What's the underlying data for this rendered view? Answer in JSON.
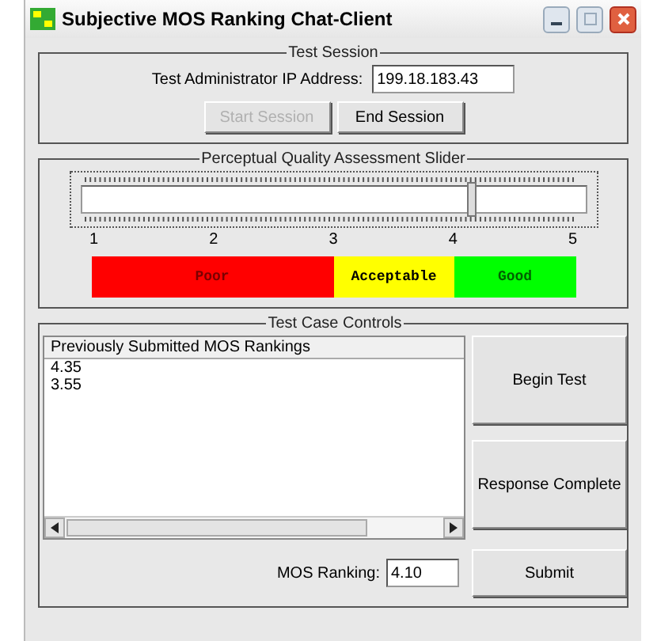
{
  "window": {
    "title": "Subjective MOS Ranking Chat-Client"
  },
  "test_session": {
    "title": "Test Session",
    "ip_label": "Test Administrator IP Address:",
    "ip_value": "199.18.183.43",
    "buttons": [
      {
        "label": "Start Session",
        "disabled": true
      },
      {
        "label": "End Session",
        "disabled": false
      }
    ]
  },
  "slider": {
    "title": "Perceptual Quality Assessment Slider",
    "level": 0.775,
    "scale": [
      "1",
      "2",
      "3",
      "4",
      "5"
    ],
    "zones": [
      {
        "label": "Poor",
        "color": "#ff0000"
      },
      {
        "label": "Acceptable",
        "color": "#ffff00"
      },
      {
        "label": "Good",
        "color": "#00ff00"
      }
    ]
  },
  "test_case": {
    "title": "Test Case Controls",
    "list_header": "Previously Submitted MOS Rankings",
    "rankings": [
      "4.35",
      "3.55"
    ],
    "mos_label": "MOS Ranking:",
    "mos_value": "4.10",
    "buttons": [
      "Begin Test",
      "Response Complete",
      "Submit"
    ]
  }
}
